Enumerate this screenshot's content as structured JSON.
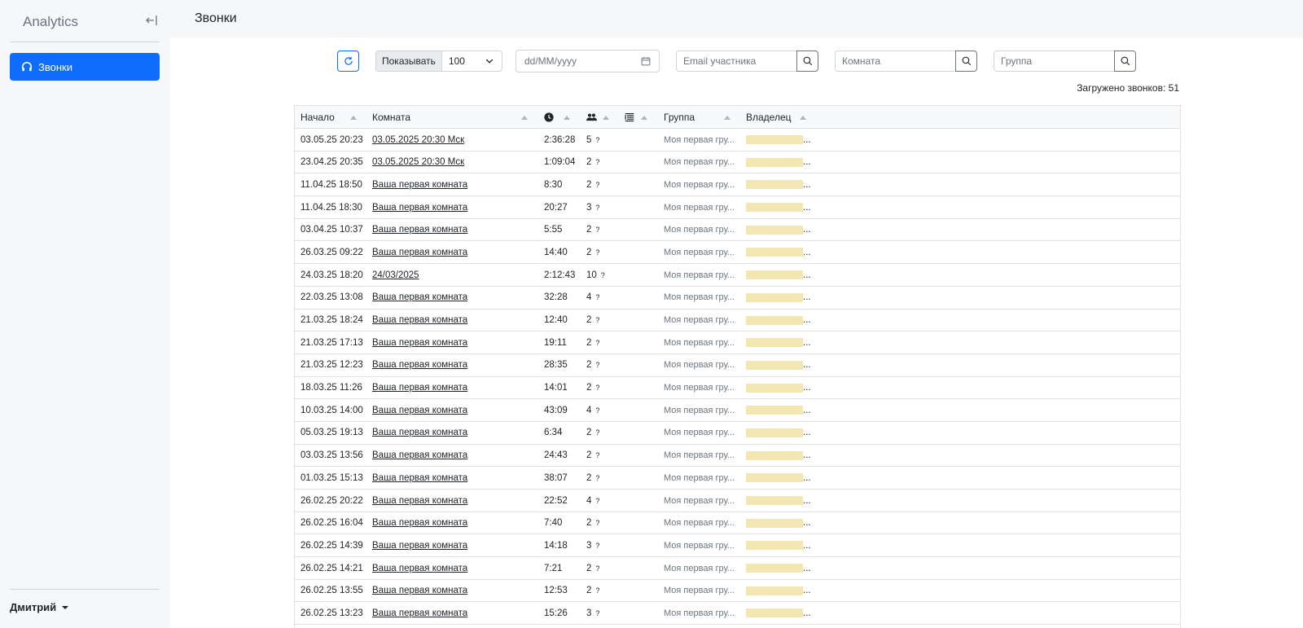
{
  "app": {
    "brand": "Analytics"
  },
  "sidebar": {
    "nav": [
      {
        "label": "Звонки",
        "icon": "headphones-icon",
        "active": true
      }
    ],
    "user": "Дмитрий"
  },
  "header": {
    "title": "Звонки"
  },
  "toolbar": {
    "show_label": "Показывать",
    "show_value": "100",
    "date_placeholder": "dd/MM/yyyy",
    "email_placeholder": "Email участника",
    "room_placeholder": "Комната",
    "group_placeholder": "Группа"
  },
  "summary": {
    "loaded_text": "Загружено звонков: 51"
  },
  "table": {
    "headers": {
      "start": "Начало",
      "room": "Комната",
      "group": "Группа",
      "owner": "Владелец"
    },
    "rows": [
      {
        "start": "03.05.25 20:23",
        "room": "03.05.2025 20:30 Мск",
        "duration": "2:36:28",
        "participants": "5",
        "group": "Моя первая гру..."
      },
      {
        "start": "23.04.25 20:35",
        "room": "03.05.2025 20:30 Мск",
        "duration": "1:09:04",
        "participants": "2",
        "group": "Моя первая гру..."
      },
      {
        "start": "11.04.25 18:50",
        "room": "Ваша первая комната",
        "duration": "8:30",
        "participants": "2",
        "group": "Моя первая гру..."
      },
      {
        "start": "11.04.25 18:30",
        "room": "Ваша первая комната",
        "duration": "20:27",
        "participants": "3",
        "group": "Моя первая гру..."
      },
      {
        "start": "03.04.25 10:37",
        "room": "Ваша первая комната",
        "duration": "5:55",
        "participants": "2",
        "group": "Моя первая гру..."
      },
      {
        "start": "26.03.25 09:22",
        "room": "Ваша первая комната",
        "duration": "14:40",
        "participants": "2",
        "group": "Моя первая гру..."
      },
      {
        "start": "24.03.25 18:20",
        "room": "24/03/2025",
        "duration": "2:12:43",
        "participants": "10",
        "group": "Моя первая гру..."
      },
      {
        "start": "22.03.25 13:08",
        "room": "Ваша первая комната",
        "duration": "32:28",
        "participants": "4",
        "group": "Моя первая гру..."
      },
      {
        "start": "21.03.25 18:24",
        "room": "Ваша первая комната",
        "duration": "12:40",
        "participants": "2",
        "group": "Моя первая гру..."
      },
      {
        "start": "21.03.25 17:13",
        "room": "Ваша первая комната",
        "duration": "19:11",
        "participants": "2",
        "group": "Моя первая гру..."
      },
      {
        "start": "21.03.25 12:23",
        "room": "Ваша первая комната",
        "duration": "28:35",
        "participants": "2",
        "group": "Моя первая гру..."
      },
      {
        "start": "18.03.25 11:26",
        "room": "Ваша первая комната",
        "duration": "14:01",
        "participants": "2",
        "group": "Моя первая гру..."
      },
      {
        "start": "10.03.25 14:00",
        "room": "Ваша первая комната",
        "duration": "43:09",
        "participants": "4",
        "group": "Моя первая гру..."
      },
      {
        "start": "05.03.25 19:13",
        "room": "Ваша первая комната",
        "duration": "6:34",
        "participants": "2",
        "group": "Моя первая гру..."
      },
      {
        "start": "03.03.25 13:56",
        "room": "Ваша первая комната",
        "duration": "24:43",
        "participants": "2",
        "group": "Моя первая гру..."
      },
      {
        "start": "01.03.25 15:13",
        "room": "Ваша первая комната",
        "duration": "38:07",
        "participants": "2",
        "group": "Моя первая гру..."
      },
      {
        "start": "26.02.25 20:22",
        "room": "Ваша первая комната",
        "duration": "22:52",
        "participants": "4",
        "group": "Моя первая гру..."
      },
      {
        "start": "26.02.25 16:04",
        "room": "Ваша первая комната",
        "duration": "7:40",
        "participants": "2",
        "group": "Моя первая гру..."
      },
      {
        "start": "26.02.25 14:39",
        "room": "Ваша первая комната",
        "duration": "14:18",
        "participants": "3",
        "group": "Моя первая гру..."
      },
      {
        "start": "26.02.25 14:21",
        "room": "Ваша первая комната",
        "duration": "7:21",
        "participants": "2",
        "group": "Моя первая гру..."
      },
      {
        "start": "26.02.25 13:55",
        "room": "Ваша первая комната",
        "duration": "12:53",
        "participants": "2",
        "group": "Моя первая гру..."
      },
      {
        "start": "26.02.25 13:23",
        "room": "Ваша первая комната",
        "duration": "15:26",
        "participants": "3",
        "group": "Моя первая гру..."
      }
    ],
    "owner_suffix": "...",
    "participants_suffix": "?"
  },
  "colors": {
    "accent": "#0d6efd",
    "redaction": "#f2e6b3"
  }
}
